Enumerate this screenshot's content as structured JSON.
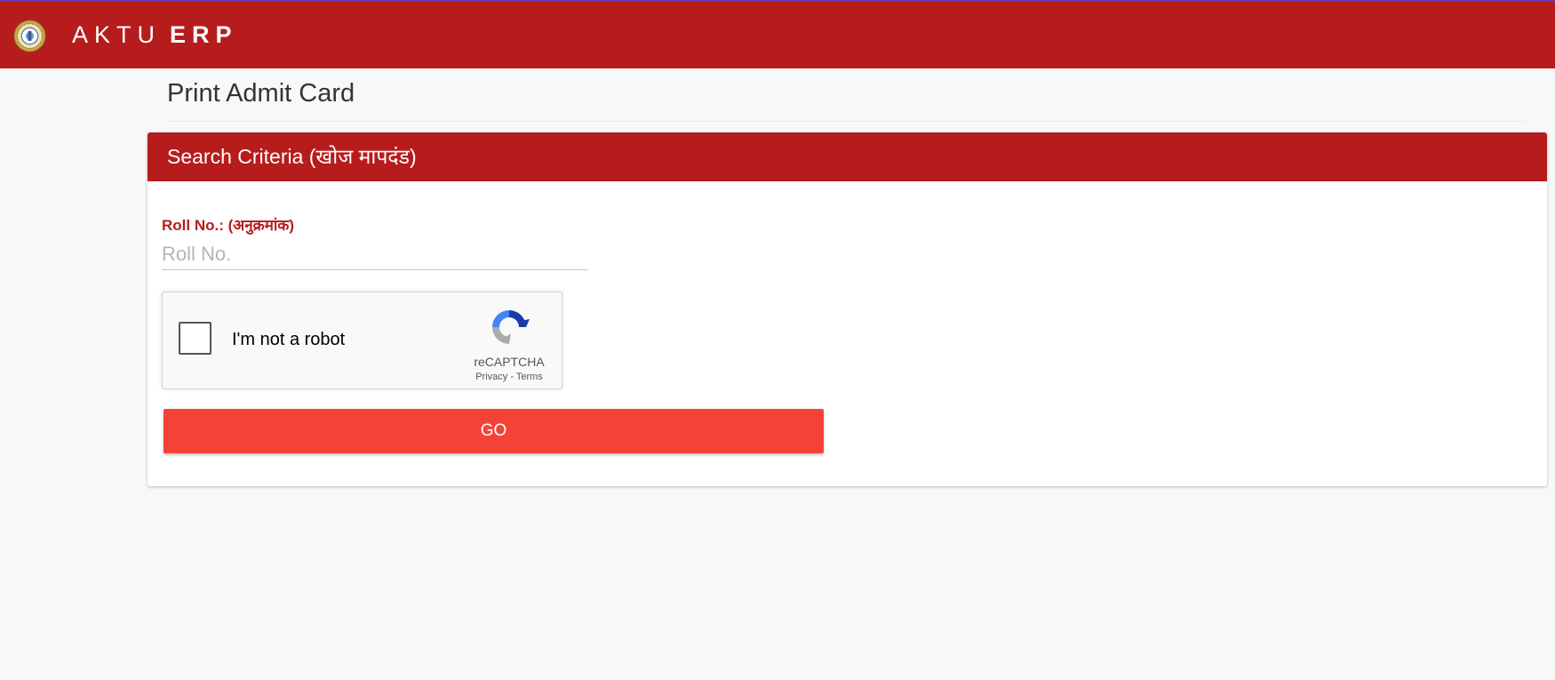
{
  "header": {
    "brand_light": "AKTU",
    "brand_bold": "ERP",
    "logo_icon": "university-seal-icon"
  },
  "page": {
    "title": "Print Admit Card"
  },
  "panel": {
    "title": "Search Criteria (खोज मापदंड)",
    "roll_label": "Roll No.: (अनुक्रमांक)",
    "roll_value": "",
    "roll_placeholder": "Roll No.",
    "go_label": "GO"
  },
  "recaptcha": {
    "label": "I'm not a robot",
    "brand": "reCAPTCHA",
    "privacy": "Privacy",
    "separator": " - ",
    "terms": "Terms",
    "checked": false
  },
  "colors": {
    "brand_red": "#b71c1c",
    "button_red": "#f44336",
    "accent_top": "#6a3ab2"
  }
}
